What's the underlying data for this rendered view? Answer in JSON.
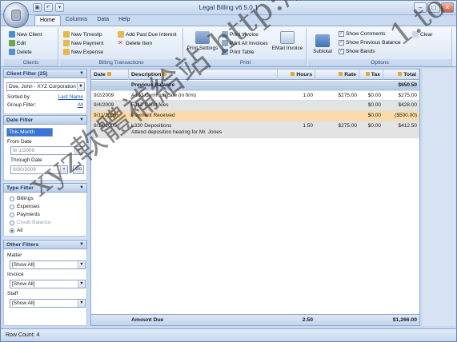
{
  "window": {
    "title": "Legal Billing v6.5.0.1",
    "qat": [
      "▣",
      "↶",
      "▾"
    ],
    "controls": [
      "–",
      "□",
      "✕"
    ]
  },
  "tabs": [
    "Home",
    "Columns",
    "Data",
    "Help"
  ],
  "ribbon": {
    "clients": {
      "label": "Clients",
      "new": "New Client",
      "edit": "Edit",
      "delete": "Delete"
    },
    "billing": {
      "label": "Billing Transactions",
      "timeslip": "New Timeslip",
      "payment": "New Payment",
      "expense": "New Expense",
      "past_due": "Add Past Due Interest",
      "delete_item": "Delete Item"
    },
    "print": {
      "label": "Print",
      "settings": "Print Settings",
      "invoice": "Print Invoice",
      "all_invoices": "Print All Invoices",
      "table": "Print Table",
      "email": "EMail Invoice"
    },
    "options": {
      "label": "Options",
      "subtotal": "Subtotal",
      "show_comments": "Show Comments",
      "show_prev_balance": "Show Previous Balance",
      "show_bands": "Show Bands",
      "clear": "Clear"
    }
  },
  "client_filter": {
    "header": "Client Filter (25)",
    "selected": "Doe, John - XYZ Corporation",
    "sorted_by_label": "Sorted by:",
    "sorted_by_value": "Last Name",
    "group_label": "Group Filter:",
    "group_value": "All"
  },
  "date_filter": {
    "header": "Date Filter",
    "preset": "This Month",
    "from_label": "From Date",
    "from_value": "9/ 1/2009",
    "through_label": "Through Date",
    "through_value": "9/30/2009",
    "go": "Go"
  },
  "type_filter": {
    "header": "Type Filter",
    "options": [
      "Billings",
      "Expenses",
      "Payments",
      "Credit Balance",
      "All"
    ]
  },
  "other_filters": {
    "header": "Other Filters",
    "matter_label": "Matter",
    "matter_value": "[Show All]",
    "invoice_label": "Invoice",
    "invoice_value": "[Show All]",
    "staff_label": "Staff",
    "staff_value": "[Show All]"
  },
  "grid": {
    "columns": [
      "Date",
      "Description",
      "Hours",
      "Rate",
      "Tax",
      "Total"
    ],
    "prev_balance": {
      "label": "Previous Balance",
      "total": "$650.50"
    },
    "rows": [
      {
        "date": "9/2/2009",
        "desc": "A103 Communicate (in firm)",
        "desc2": "",
        "hours": "1.00",
        "rate": "$275.00",
        "tax": "$0.00",
        "total": "$275.00"
      },
      {
        "date": "9/4/2009",
        "desc": "E112 Court fees",
        "desc2": "",
        "hours": "",
        "rate": "",
        "tax": "$0.00",
        "total": "$428.00"
      },
      {
        "date": "9/11/2009",
        "desc": "Payment Received",
        "desc2": "",
        "hours": "",
        "rate": "",
        "tax": "$0.00",
        "total": "($500.00)"
      },
      {
        "date": "9/14/2009",
        "desc": "L330 Depositions",
        "desc2": "Attend deposition hearing for Mr. Jones",
        "hours": "1.50",
        "rate": "$275.00",
        "tax": "$0.00",
        "total": "$412.50"
      }
    ],
    "footer": {
      "label": "Amount Due",
      "hours": "2.50",
      "total": "$1,266.00"
    }
  },
  "status": {
    "row_count": "Row Count:  4"
  },
  "watermark": {
    "text1": "xyz軟體補給站 http://3",
    "text2": "1.to"
  },
  "colors": {
    "accent": "#1e5fb3",
    "payment_row": "#fbdca8",
    "band_row": "#e3e3e3",
    "ribbon_bg": "#d9e5f4"
  }
}
